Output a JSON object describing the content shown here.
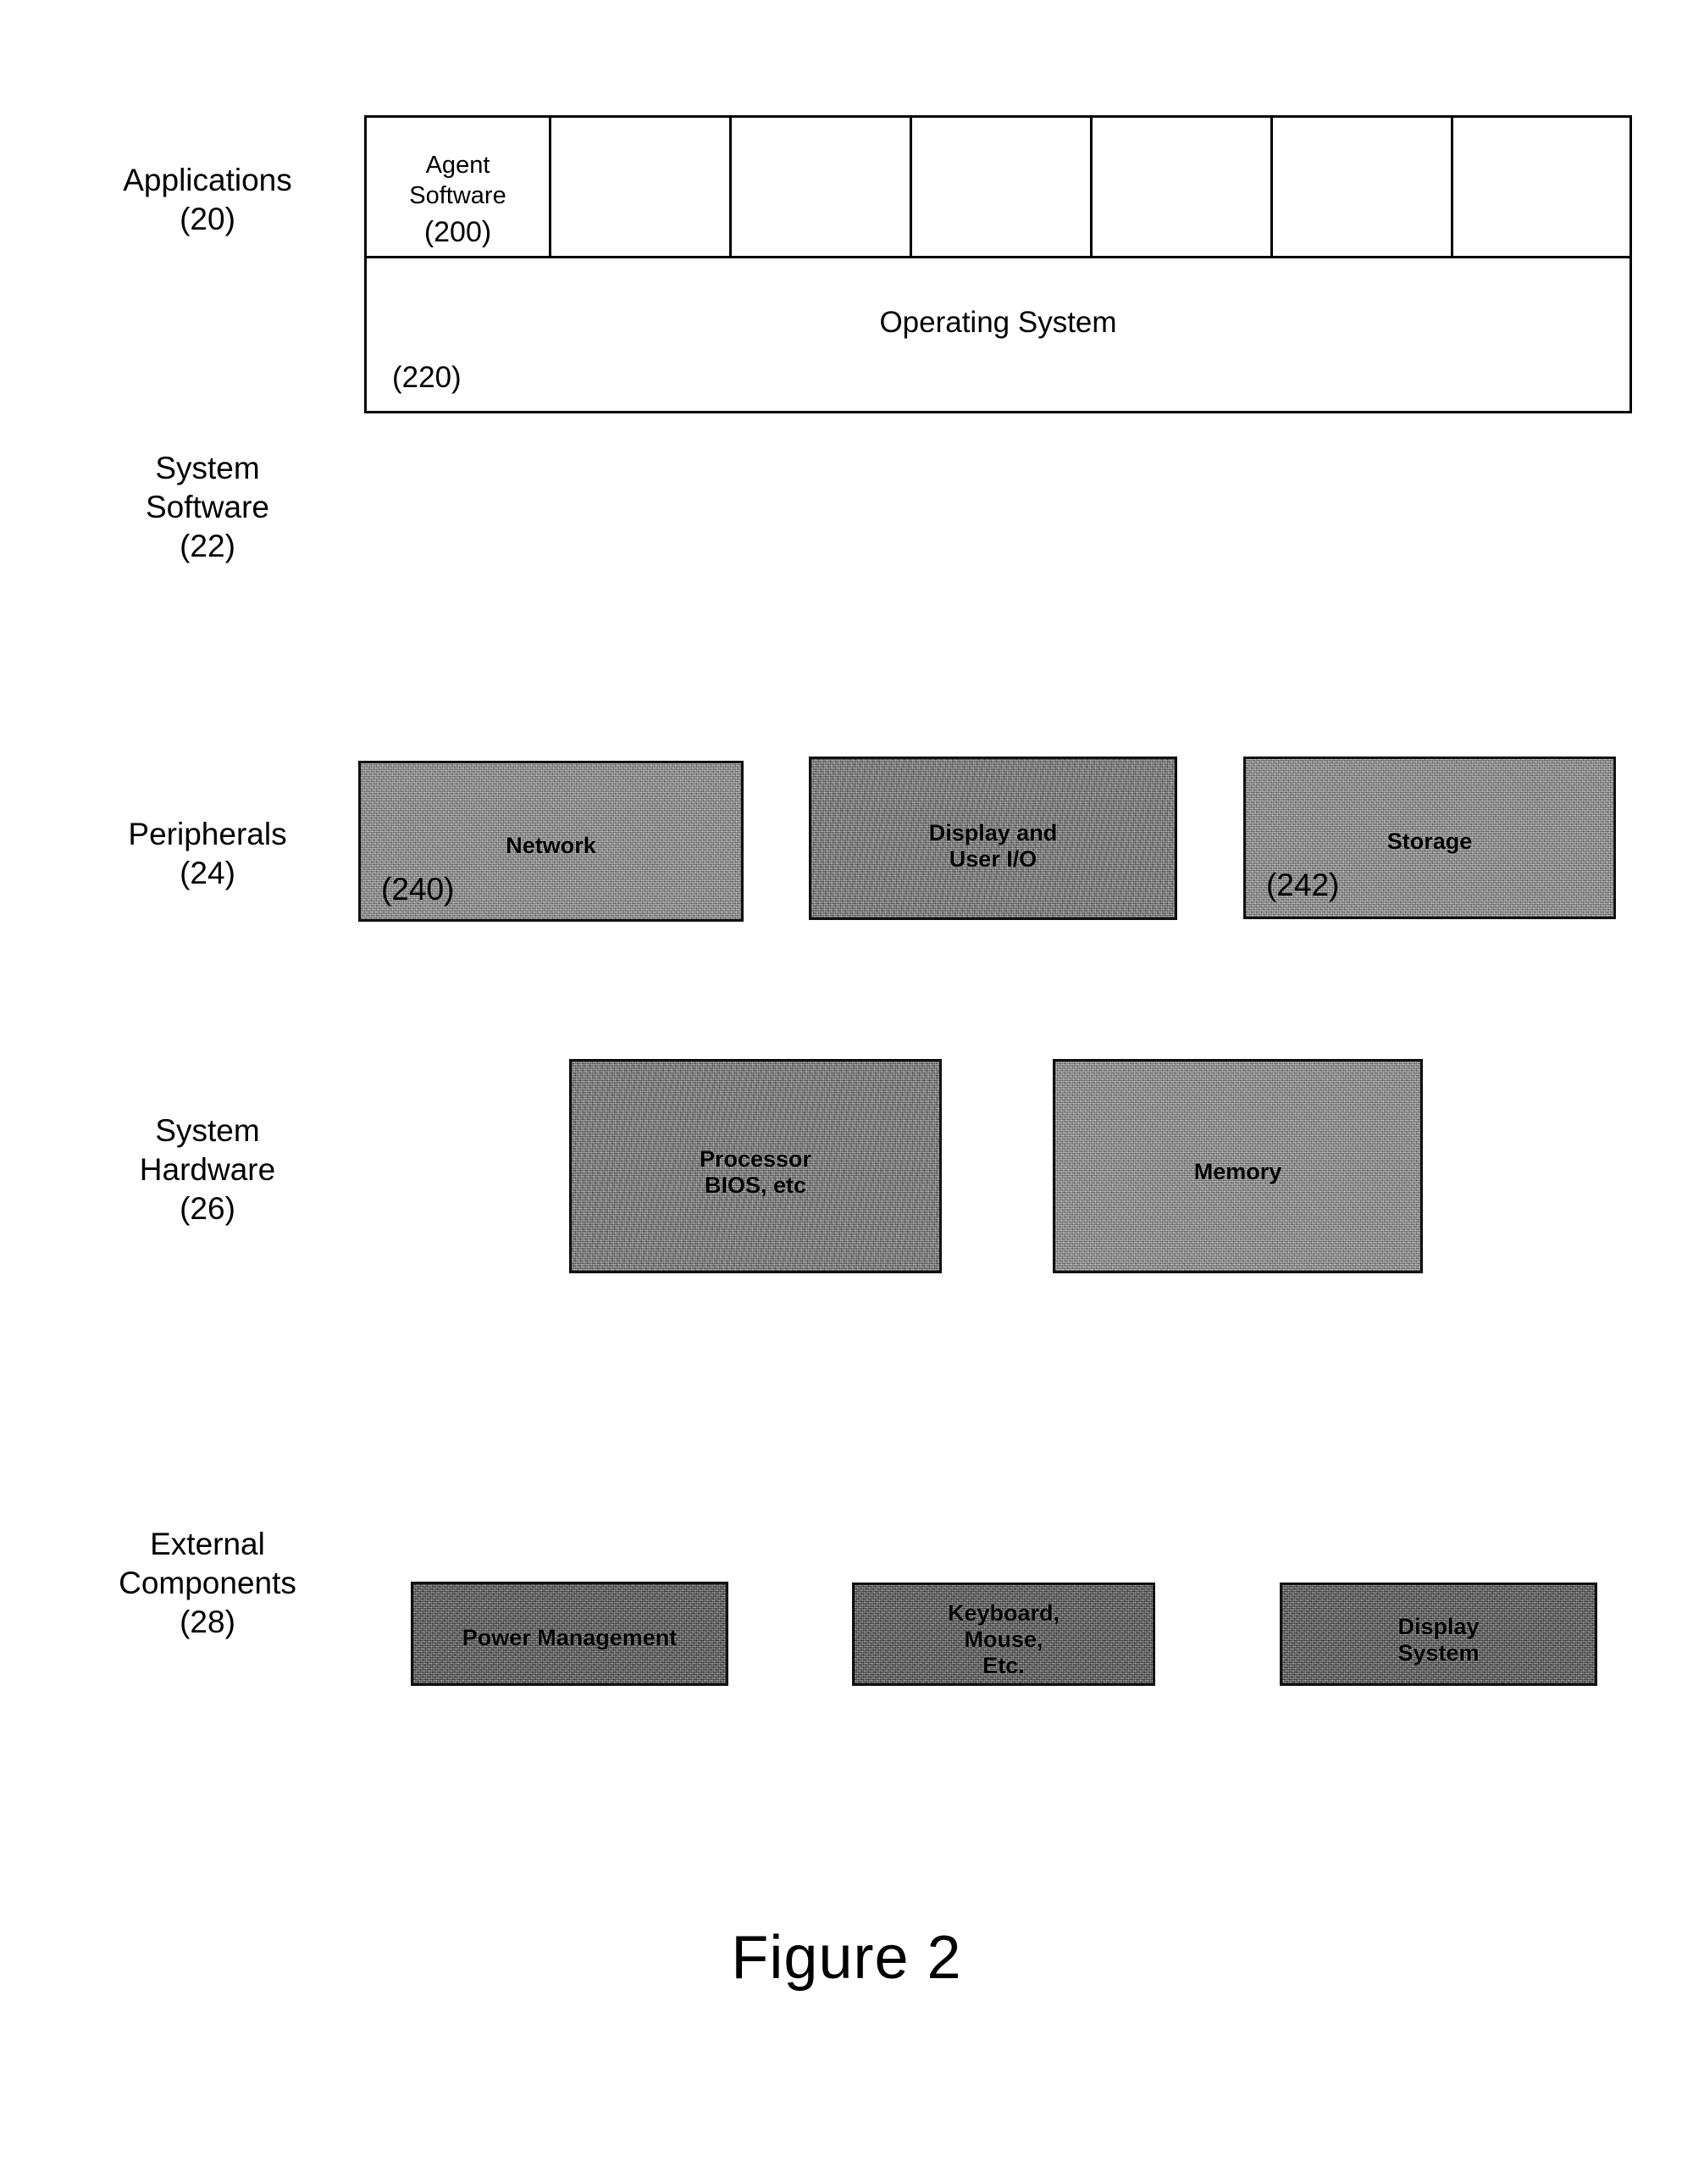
{
  "figure": {
    "caption": "Figure 2"
  },
  "row_labels": [
    {
      "id": "applications",
      "text": "Applications\n(20)"
    },
    {
      "id": "system-software",
      "text": "System\nSoftware\n(22)"
    },
    {
      "id": "peripherals",
      "text": "Peripherals\n(24)"
    },
    {
      "id": "system-hardware",
      "text": "System\nHardware\n(26)"
    },
    {
      "id": "external-components",
      "text": "External\nComponents\n(28)"
    }
  ],
  "applications": {
    "cells": [
      {
        "label": "Agent\nSoftware",
        "ref": "(200)"
      },
      {
        "label": "",
        "ref": ""
      },
      {
        "label": "",
        "ref": ""
      },
      {
        "label": "",
        "ref": ""
      },
      {
        "label": "",
        "ref": ""
      },
      {
        "label": "",
        "ref": ""
      },
      {
        "label": "",
        "ref": ""
      }
    ]
  },
  "system_software": {
    "title": "Operating System",
    "ref": "(220)"
  },
  "peripherals": {
    "blocks": [
      {
        "label": "Network",
        "ref": "(240)"
      },
      {
        "label": "Display and\nUser I/O",
        "ref": ""
      },
      {
        "label": "Storage",
        "ref": "(242)"
      }
    ]
  },
  "system_hardware": {
    "blocks": [
      {
        "label": "Processor\nBIOS, etc",
        "ref": ""
      },
      {
        "label": "Memory",
        "ref": ""
      }
    ]
  },
  "external_components": {
    "blocks": [
      {
        "label": "Power Management",
        "ref": ""
      },
      {
        "label": "Keyboard,\nMouse,\nEtc.",
        "ref": ""
      },
      {
        "label": "Display\nSystem",
        "ref": ""
      }
    ]
  },
  "colors": {
    "ink": "#000000",
    "paper": "#ffffff",
    "block_fill_light": "#b4b4b4",
    "block_fill_mid": "#a2a2a2",
    "block_fill_dark": "#8d8d8d"
  }
}
